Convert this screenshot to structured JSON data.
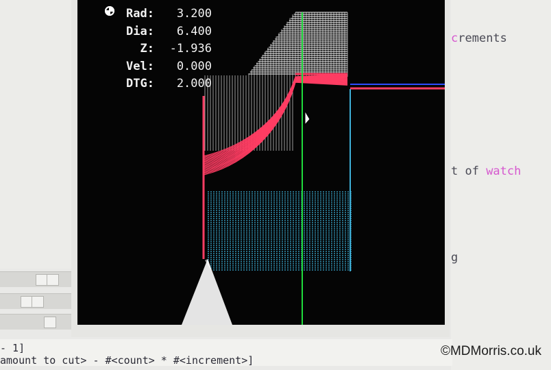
{
  "dro": {
    "rad_label": "Rad:",
    "rad_value": "3.200",
    "dia_label": "Dia:",
    "dia_value": "6.400",
    "z_label": "Z:",
    "z_value": "-1.936",
    "vel_label": "Vel:",
    "vel_value": "0.000",
    "dtg_label": "DTG:",
    "dtg_value": "2.000"
  },
  "help_text": {
    "line1_magenta": "c",
    "line1_rest": "rements",
    "line2_pre": "t of ",
    "line2_magenta": "watch",
    "line3": "g"
  },
  "console": {
    "line1": "- 1]",
    "line2": "amount to cut> - #<count> * #<increment>]"
  },
  "watermark": "©MDMorris.co.uk",
  "colors": {
    "toolpath_feed": "#ff3d63",
    "toolpath_traverse": "#ffffff",
    "toolpath_preview": "#3fb2da",
    "z_axis": "#1fdd3c",
    "spindle_line": "#2e4bff"
  }
}
